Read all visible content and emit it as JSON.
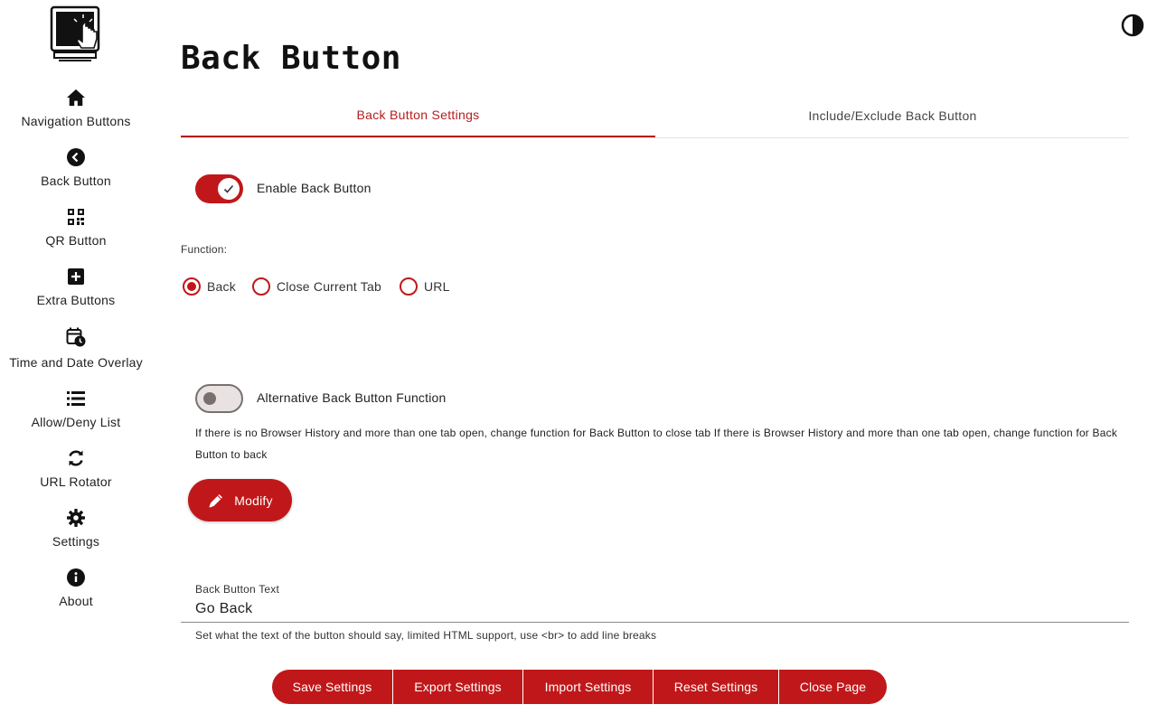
{
  "colors": {
    "accent": "#c0181a",
    "text": "#222222"
  },
  "sidebar": {
    "items": [
      {
        "label": "Navigation Buttons",
        "icon": "home-icon"
      },
      {
        "label": "Back Button",
        "icon": "back-circle-icon"
      },
      {
        "label": "QR Button",
        "icon": "qr-code-icon"
      },
      {
        "label": "Extra Buttons",
        "icon": "plus-square-icon"
      },
      {
        "label": "Time and Date Overlay",
        "icon": "calendar-clock-icon"
      },
      {
        "label": "Allow/Deny List",
        "icon": "list-icon"
      },
      {
        "label": "URL Rotator",
        "icon": "rotate-icon"
      },
      {
        "label": "Settings",
        "icon": "gear-icon"
      },
      {
        "label": "About",
        "icon": "info-icon"
      }
    ]
  },
  "header": {
    "title": "Back Button"
  },
  "tabs": [
    {
      "label": "Back Button Settings",
      "active": true
    },
    {
      "label": "Include/Exclude Back Button",
      "active": false
    }
  ],
  "main": {
    "enable_toggle": {
      "label": "Enable Back Button",
      "on": true
    },
    "function": {
      "label": "Function:",
      "options": [
        {
          "label": "Back",
          "checked": true
        },
        {
          "label": "Close Current Tab",
          "checked": false
        },
        {
          "label": "URL",
          "checked": false
        }
      ]
    },
    "alt_toggle": {
      "label": "Alternative Back Button Function",
      "on": false
    },
    "alt_help": "If there is no Browser History and more than one tab open, change function for Back Button to close tab If there is Browser History and more than one tab open, change function for Back Button to back",
    "modify_label": "Modify",
    "text_field": {
      "label": "Back Button Text",
      "value": "Go Back",
      "help": "Set what the text of the button should say, limited HTML support, use <br> to add line breaks"
    }
  },
  "actions": [
    {
      "label": "Save Settings"
    },
    {
      "label": "Export Settings"
    },
    {
      "label": "Import Settings"
    },
    {
      "label": "Reset Settings"
    },
    {
      "label": "Close Page"
    }
  ]
}
